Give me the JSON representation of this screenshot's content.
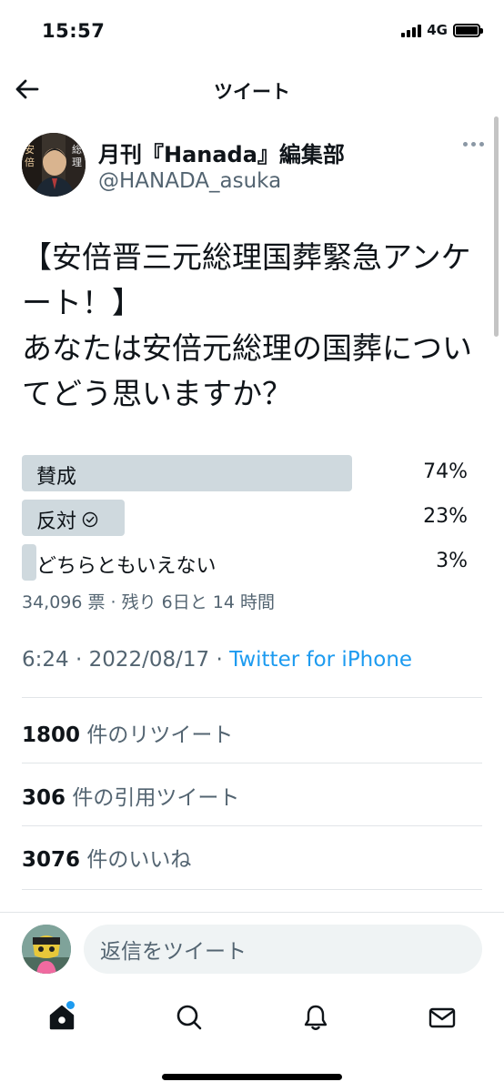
{
  "status_bar": {
    "time": "15:57",
    "network": "4G"
  },
  "nav": {
    "title": "ツイート",
    "back_icon": "arrow-left-icon"
  },
  "tweet": {
    "author_name": "月刊『Hanada』編集部",
    "author_handle": "@HANADA_asuka",
    "text": "【安倍晋三元総理国葬緊急アンケート！】\nあなたは安倍元総理の国葬についてどう思いますか？",
    "poll": {
      "options": [
        {
          "label": "賛成",
          "percent_text": "74%",
          "percent": 74,
          "voted": false
        },
        {
          "label": "反対",
          "percent_text": "23%",
          "percent": 23,
          "voted": true
        },
        {
          "label": "どちらともいえない",
          "percent_text": "3%",
          "percent": 3,
          "voted": false
        }
      ],
      "meta": "34,096 票 · 残り 6日と 14 時間"
    },
    "timestamp": "6:24 · 2022/08/17 · ",
    "source": "Twitter for iPhone"
  },
  "stats": {
    "retweets_count": "1800",
    "retweets_label": "件のリツイート",
    "quotes_count": "306",
    "quotes_label": "件の引用ツイート",
    "likes_count": "3076",
    "likes_label": "件のいいね"
  },
  "reply": {
    "placeholder": "返信をツイート"
  },
  "colors": {
    "accent": "#1d9bf0",
    "poll_bar": "#cfd9de",
    "secondary_text": "#536471"
  }
}
